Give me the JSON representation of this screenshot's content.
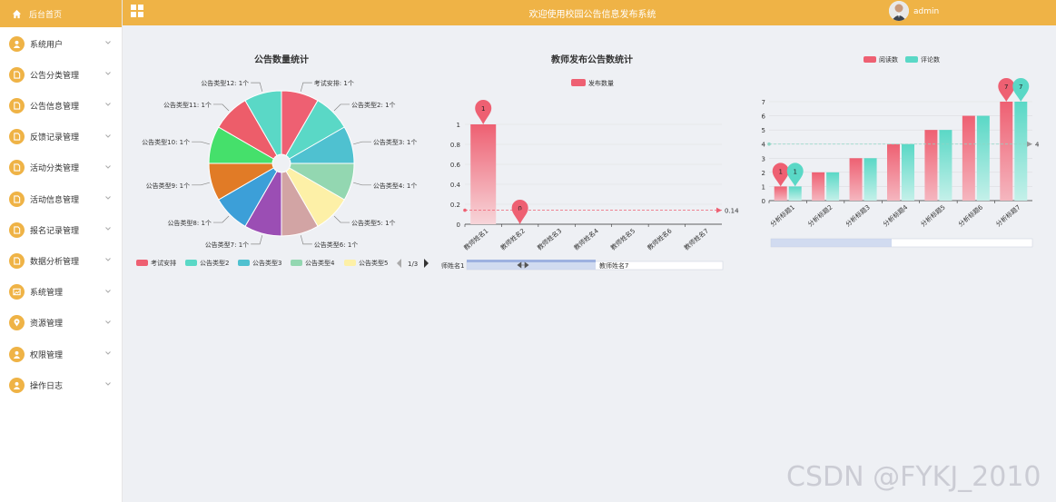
{
  "header": {
    "title": "欢迎使用校园公告信息发布系统",
    "user": "admin"
  },
  "sidebar": {
    "home_label": "后台首页",
    "items": [
      {
        "label": "系统用户",
        "icon": "user-icon"
      },
      {
        "label": "公告分类管理",
        "icon": "file-icon"
      },
      {
        "label": "公告信息管理",
        "icon": "file-icon"
      },
      {
        "label": "反馈记录管理",
        "icon": "file-icon"
      },
      {
        "label": "活动分类管理",
        "icon": "file-icon"
      },
      {
        "label": "活动信息管理",
        "icon": "file-icon"
      },
      {
        "label": "报名记录管理",
        "icon": "file-icon"
      },
      {
        "label": "数据分析管理",
        "icon": "file-icon"
      },
      {
        "label": "系统管理",
        "icon": "image-icon"
      },
      {
        "label": "资源管理",
        "icon": "location-icon"
      },
      {
        "label": "权限管理",
        "icon": "user-icon"
      },
      {
        "label": "操作日志",
        "icon": "user-icon"
      }
    ]
  },
  "colors": {
    "accent": "#efb346",
    "palette": [
      "#ee6072",
      "#5ad8c6",
      "#4fc1d0",
      "#93d7b1",
      "#fdf0a7",
      "#d2a4a4",
      "#9b4eb4",
      "#3c9fd8",
      "#e17b26",
      "#45e06b",
      "#ed5d6a",
      "#5ad8c6"
    ]
  },
  "watermark": "CSDN @FYKJ_2010",
  "chart_data": [
    {
      "type": "pie",
      "title": "公告数量统计",
      "slices": [
        {
          "name": "考试安排",
          "value": 1
        },
        {
          "name": "公告类型2",
          "value": 1
        },
        {
          "name": "公告类型3",
          "value": 1
        },
        {
          "name": "公告类型4",
          "value": 1
        },
        {
          "name": "公告类型5",
          "value": 1
        },
        {
          "name": "公告类型6",
          "value": 1
        },
        {
          "name": "公告类型7",
          "value": 1
        },
        {
          "name": "公告类型8",
          "value": 1
        },
        {
          "name": "公告类型9",
          "value": 1
        },
        {
          "name": "公告类型10",
          "value": 1
        },
        {
          "name": "公告类型11",
          "value": 1
        },
        {
          "name": "公告类型12",
          "value": 1
        }
      ],
      "label_suffix": ": 1个",
      "legend": [
        "考试安排",
        "公告类型2",
        "公告类型3",
        "公告类型4",
        "公告类型5"
      ],
      "legend_page": "1/3"
    },
    {
      "type": "bar",
      "title": "教师发布公告数统计",
      "legend": [
        "发布数量"
      ],
      "categories": [
        "教师姓名1",
        "教师姓名2",
        "教师姓名3",
        "教师姓名4",
        "教师姓名5",
        "教师姓名6",
        "教师姓名7"
      ],
      "values": [
        1,
        0,
        0,
        0,
        0,
        0,
        0
      ],
      "yticks": [
        "0",
        "0.2",
        "0.4",
        "0.6",
        "0.8",
        "1"
      ],
      "ylim": [
        0,
        1
      ],
      "mark_points": [
        "1",
        "0"
      ],
      "mark_line": "0.14",
      "zoom_start": "师姓名1",
      "zoom_end": "教师姓名7"
    },
    {
      "type": "bar",
      "title": "",
      "legend": [
        "阅读数",
        "评论数"
      ],
      "categories": [
        "分析标题1",
        "分析标题2",
        "分析标题3",
        "分析标题4",
        "分析标题5",
        "分析标题6",
        "分析标题7"
      ],
      "series": [
        {
          "name": "阅读数",
          "values": [
            1,
            2,
            3,
            4,
            5,
            6,
            7
          ]
        },
        {
          "name": "评论数",
          "values": [
            1,
            2,
            3,
            4,
            5,
            6,
            7
          ]
        }
      ],
      "yticks": [
        "0",
        "1",
        "2",
        "3",
        "4",
        "5",
        "6",
        "7"
      ],
      "ylim": [
        0,
        7
      ],
      "mark_points": [
        "1",
        "1",
        "7",
        "7"
      ],
      "mark_line": "4"
    }
  ]
}
